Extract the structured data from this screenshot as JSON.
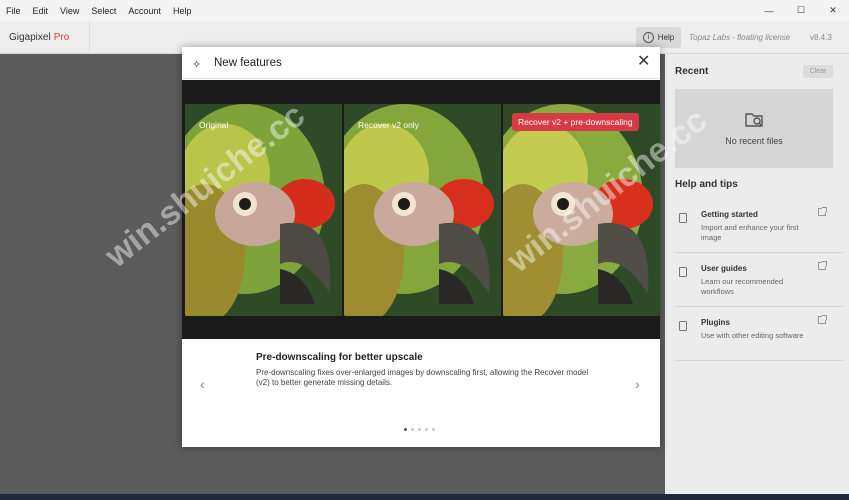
{
  "menu": [
    "File",
    "Edit",
    "View",
    "Select",
    "Account",
    "Help"
  ],
  "window_controls": [
    "—",
    "☐",
    "✕"
  ],
  "app": {
    "name": "Gigapixel",
    "edition": "Pro",
    "help_label": "Help",
    "license": "Topaz Labs - floating license",
    "version": "v8.4.3"
  },
  "recent": {
    "title": "Recent",
    "clear_label": "Clear",
    "empty_label": "No recent files"
  },
  "help_tips": {
    "title": "Help and tips",
    "items": [
      {
        "title": "Getting started",
        "desc": "Import and enhance your first image"
      },
      {
        "title": "User guides",
        "desc": "Learn our recommended workflows"
      },
      {
        "title": "Plugins",
        "desc": "Use with other editing software"
      }
    ]
  },
  "modal": {
    "title": "New features",
    "panels": [
      "Original",
      "Recover v2 only",
      "Recover v2 + pre-downscaling"
    ],
    "feature_title": "Pre-downscaling for better upscale",
    "feature_desc": "Pre-downscaling fixes over-enlarged images by downscaling first, allowing the Recover model (v2) to better generate missing details.",
    "prev": "‹",
    "next": "›",
    "slides": 5,
    "active_slide": 0
  },
  "watermarks": [
    "win.shuiche.cc",
    "win.shuiche.cc"
  ],
  "colors": {
    "accent_red": "#e23a3a",
    "badge_red": "#d63a45",
    "modal_media_bg": "#1a1a1a",
    "background": "#5b5b5b"
  }
}
